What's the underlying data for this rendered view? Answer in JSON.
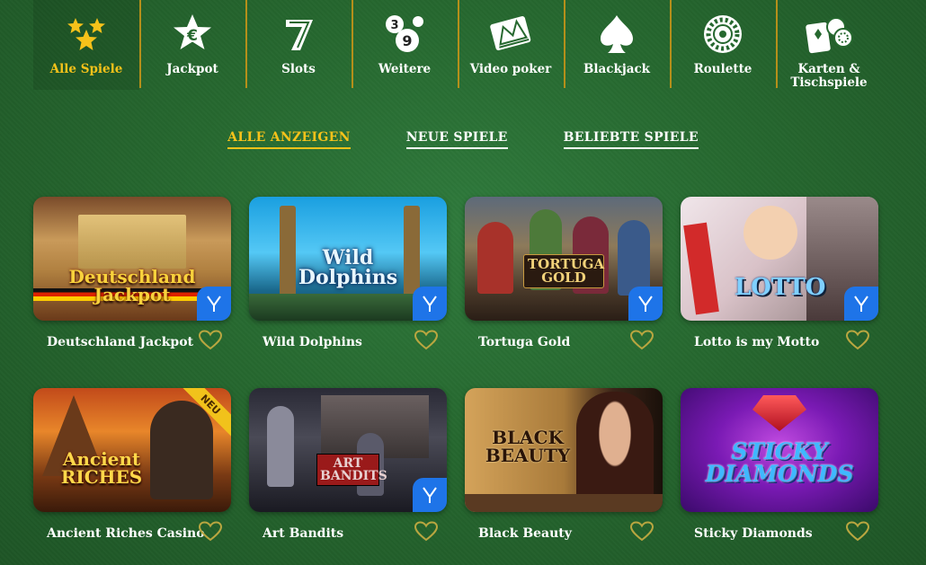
{
  "categories": [
    {
      "key": "all",
      "label": "Alle Spiele",
      "icon": "stars-icon",
      "active": true
    },
    {
      "key": "jackpot",
      "label": "Jackpot",
      "icon": "euro-star-icon",
      "active": false
    },
    {
      "key": "slots",
      "label": "Slots",
      "icon": "seven-icon",
      "active": false
    },
    {
      "key": "more",
      "label": "Weitere",
      "icon": "lottery-balls-icon",
      "active": false
    },
    {
      "key": "videopoker",
      "label": "Video poker",
      "icon": "playing-cards-king-icon",
      "active": false
    },
    {
      "key": "blackjack",
      "label": "Blackjack",
      "icon": "spade-icon",
      "active": false
    },
    {
      "key": "roulette",
      "label": "Roulette",
      "icon": "roulette-wheel-icon",
      "active": false
    },
    {
      "key": "cards",
      "label": "Karten & Tischspiele",
      "icon": "cards-chips-icon",
      "active": false
    }
  ],
  "filters": [
    {
      "label": "ALLE ANZEIGEN",
      "active": true
    },
    {
      "label": "NEUE SPIELE",
      "active": false
    },
    {
      "label": "BELIEBTE SPIELE",
      "active": false
    }
  ],
  "games": [
    {
      "name": "Deutschland Jackpot",
      "art_text": "Deutschland Jackpot",
      "badge": "V",
      "new": false
    },
    {
      "name": "Wild Dolphins",
      "art_text": "Wild Dolphins",
      "badge": "V",
      "new": false
    },
    {
      "name": "Tortuga Gold",
      "art_text": "TORTUGA GOLD",
      "badge": "V",
      "new": false
    },
    {
      "name": "Lotto is my Motto",
      "art_text": "LOTTO",
      "badge": "V",
      "new": false
    },
    {
      "name": "Ancient Riches Casino",
      "art_text": "Ancient RICHES",
      "badge": "",
      "new": true,
      "new_label": "NEU"
    },
    {
      "name": "Art Bandits",
      "art_text": "ART BANDITS",
      "badge": "V",
      "new": false
    },
    {
      "name": "Black Beauty",
      "art_text": "BLACK BEAUTY",
      "badge": "",
      "new": false
    },
    {
      "name": "Sticky Diamonds",
      "art_text": "STICKY DIAMONDS",
      "badge": "",
      "new": false
    }
  ],
  "colors": {
    "accent": "#f6c21a",
    "badge": "#1e74e8",
    "divider": "#b58f1a",
    "background": "#26682f"
  }
}
